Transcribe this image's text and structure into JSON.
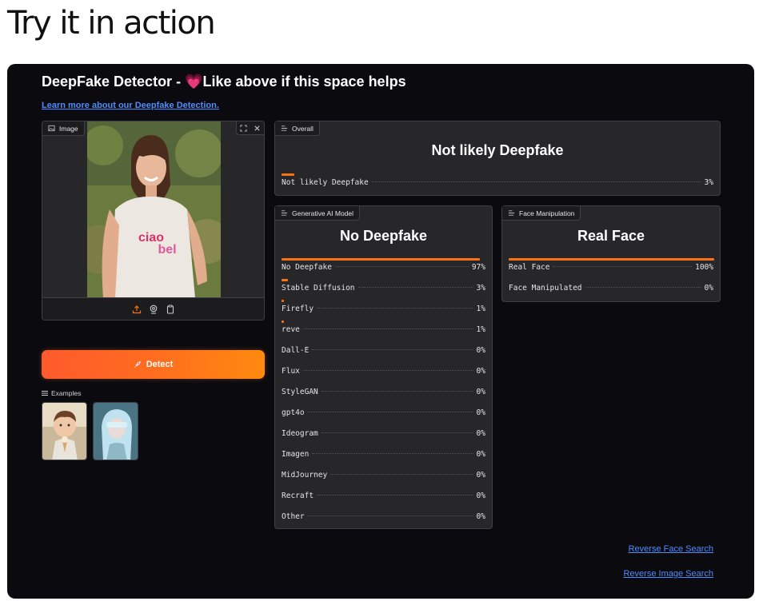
{
  "page": {
    "heading": "Try it in action"
  },
  "app": {
    "title": "DeepFake Detector - ",
    "title_heart": "💗",
    "title_tail": "Like above if this space helps",
    "learn_link": "Learn more about our Deepfake Detection."
  },
  "image_panel": {
    "label": "Image"
  },
  "detect_button": {
    "label": "Detect"
  },
  "examples": {
    "label": "Examples",
    "count": 2
  },
  "overall": {
    "tag": "Overall",
    "title": "Not likely Deepfake",
    "rows": [
      {
        "label": "Not likely Deepfake",
        "value": "3%",
        "fraction": 0.03
      }
    ]
  },
  "generative": {
    "tag": "Generative AI Model",
    "title": "No Deepfake",
    "rows": [
      {
        "label": "No Deepfake",
        "value": "97%",
        "fraction": 0.97
      },
      {
        "label": "Stable Diffusion",
        "value": "3%",
        "fraction": 0.03
      },
      {
        "label": "Firefly",
        "value": "1%",
        "fraction": 0.01
      },
      {
        "label": "reve",
        "value": "1%",
        "fraction": 0.01
      },
      {
        "label": "Dall-E",
        "value": "0%",
        "fraction": 0
      },
      {
        "label": "Flux",
        "value": "0%",
        "fraction": 0
      },
      {
        "label": "StyleGAN",
        "value": "0%",
        "fraction": 0
      },
      {
        "label": "gpt4o",
        "value": "0%",
        "fraction": 0
      },
      {
        "label": "Ideogram",
        "value": "0%",
        "fraction": 0
      },
      {
        "label": "Imagen",
        "value": "0%",
        "fraction": 0
      },
      {
        "label": "MidJourney",
        "value": "0%",
        "fraction": 0
      },
      {
        "label": "Recraft",
        "value": "0%",
        "fraction": 0
      },
      {
        "label": "Other",
        "value": "0%",
        "fraction": 0
      }
    ]
  },
  "face": {
    "tag": "Face Manipulation",
    "title": "Real Face",
    "rows": [
      {
        "label": "Real Face",
        "value": "100%",
        "fraction": 1.0
      },
      {
        "label": "Face Manipulated",
        "value": "0%",
        "fraction": 0
      }
    ]
  },
  "links": {
    "reverse_face": "Reverse Face Search",
    "reverse_image": "Reverse Image Search"
  },
  "colors": {
    "accent": "#f97316",
    "link": "#4c8dff",
    "panel": "#27272a",
    "background": "#0b0b0f"
  }
}
